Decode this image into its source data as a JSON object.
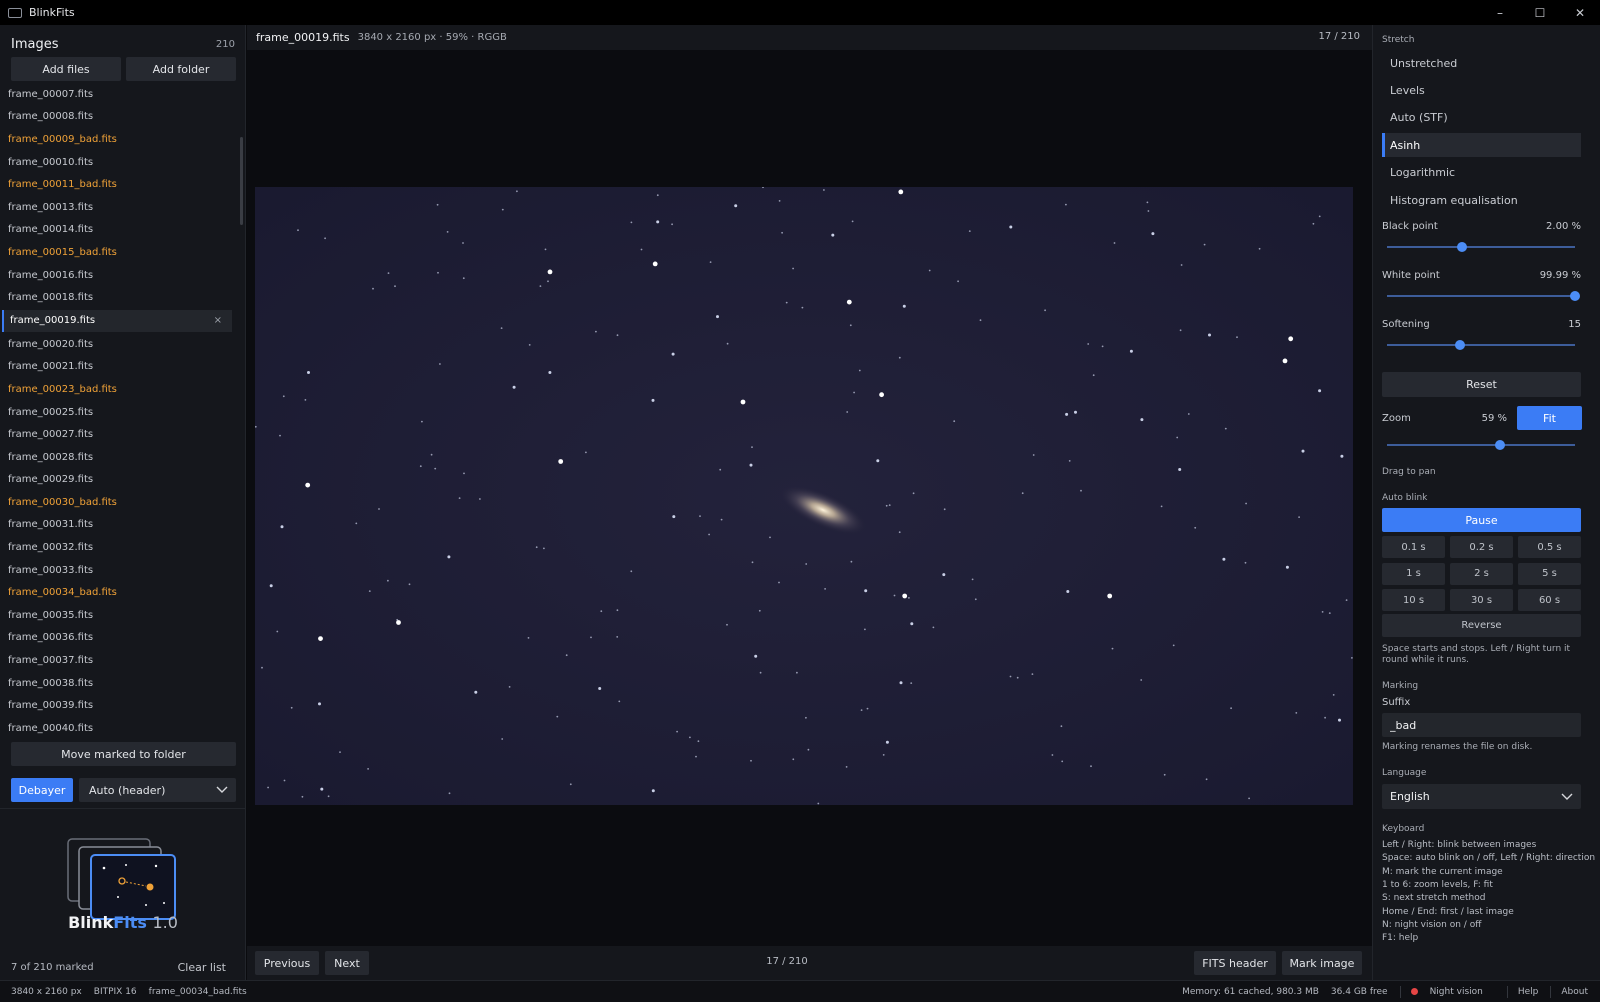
{
  "window": {
    "title": "BlinkFits",
    "minimize": "–",
    "maximize": "☐",
    "close": "✕"
  },
  "left": {
    "title": "Images",
    "count": "210",
    "add_files": "Add files",
    "add_folder": "Add folder",
    "files": [
      {
        "name": "frame_00007.fits",
        "bad": false
      },
      {
        "name": "frame_00008.fits",
        "bad": false
      },
      {
        "name": "frame_00009_bad.fits",
        "bad": true
      },
      {
        "name": "frame_00010.fits",
        "bad": false
      },
      {
        "name": "frame_00011_bad.fits",
        "bad": true
      },
      {
        "name": "frame_00013.fits",
        "bad": false
      },
      {
        "name": "frame_00014.fits",
        "bad": false
      },
      {
        "name": "frame_00015_bad.fits",
        "bad": true
      },
      {
        "name": "frame_00016.fits",
        "bad": false
      },
      {
        "name": "frame_00018.fits",
        "bad": false
      },
      {
        "name": "frame_00019.fits",
        "bad": false,
        "selected": true
      },
      {
        "name": "frame_00020.fits",
        "bad": false
      },
      {
        "name": "frame_00021.fits",
        "bad": false
      },
      {
        "name": "frame_00023_bad.fits",
        "bad": true
      },
      {
        "name": "frame_00025.fits",
        "bad": false
      },
      {
        "name": "frame_00027.fits",
        "bad": false
      },
      {
        "name": "frame_00028.fits",
        "bad": false
      },
      {
        "name": "frame_00029.fits",
        "bad": false
      },
      {
        "name": "frame_00030_bad.fits",
        "bad": true
      },
      {
        "name": "frame_00031.fits",
        "bad": false
      },
      {
        "name": "frame_00032.fits",
        "bad": false
      },
      {
        "name": "frame_00033.fits",
        "bad": false
      },
      {
        "name": "frame_00034_bad.fits",
        "bad": true
      },
      {
        "name": "frame_00035.fits",
        "bad": false
      },
      {
        "name": "frame_00036.fits",
        "bad": false
      },
      {
        "name": "frame_00037.fits",
        "bad": false
      },
      {
        "name": "frame_00038.fits",
        "bad": false
      },
      {
        "name": "frame_00039.fits",
        "bad": false
      },
      {
        "name": "frame_00040.fits",
        "bad": false
      }
    ],
    "remove_glyph": "×",
    "move_marked": "Move marked to folder",
    "debayer": "Debayer",
    "debayer_mode": "Auto (header)",
    "brand_blink": "Blink",
    "brand_fits": "Fits",
    "brand_version": "1.0",
    "marked_status": "7 of 210 marked",
    "clear_list": "Clear list"
  },
  "main": {
    "filename": "frame_00019.fits",
    "meta": "3840 x 2160 px  ·  59%  ·  RGGB",
    "counter": "17 / 210",
    "previous": "Previous",
    "next": "Next",
    "bottom_counter": "17 / 210",
    "fits_header": "FITS header",
    "mark_image": "Mark image"
  },
  "right": {
    "stretch_title": "Stretch",
    "stretch_options": [
      "Unstretched",
      "Levels",
      "Auto (STF)",
      "Asinh",
      "Logarithmic",
      "Histogram equalisation"
    ],
    "stretch_active": "Asinh",
    "black_point_label": "Black point",
    "black_point_value": "2.00 %",
    "black_point_fraction": 0.4,
    "white_point_label": "White point",
    "white_point_value": "99.99 %",
    "white_point_fraction": 1.0,
    "softening_label": "Softening",
    "softening_value": "15",
    "softening_fraction": 0.39,
    "reset": "Reset",
    "zoom_label": "Zoom",
    "zoom_value": "59 %",
    "zoom_fraction": 0.6,
    "fit": "Fit",
    "drag_to_pan": "Drag to pan",
    "auto_blink_title": "Auto blink",
    "pause": "Pause",
    "speeds": [
      "0.1 s",
      "0.2 s",
      "0.5 s",
      "1 s",
      "2 s",
      "5 s",
      "10 s",
      "30 s",
      "60 s"
    ],
    "reverse": "Reverse",
    "blink_note": "Space starts and stops. Left / Right turn it round while it runs.",
    "marking_title": "Marking",
    "suffix_label": "Suffix",
    "suffix_value": "_bad",
    "marking_note": "Marking renames the file on disk.",
    "language_title": "Language",
    "language_value": "English",
    "keyboard_title": "Keyboard",
    "keyboard_lines": [
      "Left / Right: blink between images",
      "Space: auto blink on / off, Left / Right: direction",
      "M: mark the current image",
      "1 to 6: zoom levels, F: fit",
      "S: next stretch method",
      "Home / End: first / last image",
      "N: night vision on / off",
      "F1: help"
    ]
  },
  "status": {
    "dims": "3840 x 2160 px",
    "bitpix": "BITPIX 16",
    "file": "frame_00034_bad.fits",
    "memory": "Memory: 61 cached, 980.3 MB",
    "disk": "36.4 GB free",
    "night_vision": "Night vision",
    "help": "Help",
    "about": "About"
  },
  "colors": {
    "accent": "#3b7cf5",
    "bad_file": "#f0a238",
    "sky": "#1c1c33"
  }
}
